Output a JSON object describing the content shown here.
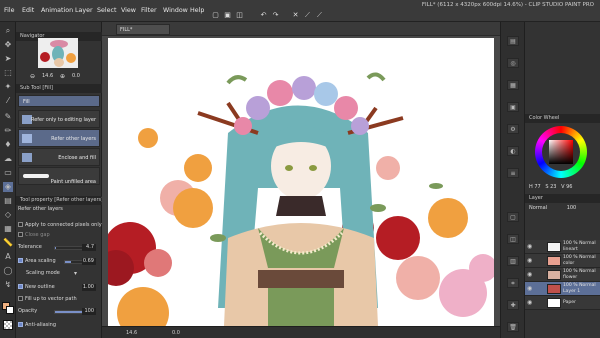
{
  "menu": {
    "items": [
      "File",
      "Edit",
      "Animation",
      "Layer",
      "Select",
      "View",
      "Filter",
      "Window",
      "Help"
    ],
    "title": "FILL* (6112 x 4320px 600dpi 14.6%) - CLIP STUDIO PAINT PRO"
  },
  "navigator": {
    "header": "Navigator",
    "zoom": "14.6",
    "angle": "0.0"
  },
  "subtool": {
    "header": "Sub Tool [Fill]",
    "tool_name": "Fill",
    "items": [
      {
        "label": "Refer only to editing layer",
        "selected": false
      },
      {
        "label": "Refer other layers",
        "selected": true
      },
      {
        "label": "Enclose and fill",
        "selected": false
      },
      {
        "label": "Paint unfilled area",
        "selected": false
      }
    ]
  },
  "tool_property": {
    "header": "Tool property [Refer other layers]",
    "preset": "Refer other layers",
    "apply_connected": "Apply to connected pixels only",
    "close_gap": "Close gap",
    "tolerance_label": "Tolerance",
    "tolerance_value": "4.7",
    "tolerance_pct": 0.05,
    "area_scaling_label": "Area scaling",
    "area_scaling_value": "0.69",
    "area_scaling_pct": 0.35,
    "scaling_mode_label": "Scaling mode",
    "new_outline_label": "New outline",
    "new_outline_value": "1.00",
    "fill_vector_label": "Fill up to vector path",
    "opacity_label": "Opacity",
    "opacity_value": "100",
    "anti_aliasing_label": "Anti-aliasing"
  },
  "canvas": {
    "tab_label": "FILL*",
    "status_zoom": "14.6",
    "status_angle": "0.0"
  },
  "color_wheel": {
    "header": "Color Wheel",
    "h": "77",
    "s": "23",
    "v": "96"
  },
  "layers": {
    "header": "Layer",
    "blend_mode": "Normal",
    "opacity": "100",
    "rows": [
      {
        "pct": "100 %",
        "mode": "Normal",
        "name": "lineart",
        "selected": false
      },
      {
        "pct": "100 %",
        "mode": "Normal",
        "name": "color",
        "selected": false
      },
      {
        "pct": "100 %",
        "mode": "Normal",
        "name": "flower",
        "selected": false
      },
      {
        "pct": "100 %",
        "mode": "Normal",
        "name": "Layer 1",
        "selected": true
      },
      {
        "pct": "",
        "mode": "",
        "name": "Paper",
        "selected": false
      }
    ]
  },
  "colors": {
    "accent": "#5c6f97",
    "hair": "#6fb3b8",
    "rose_red": "#b51d24",
    "peony_orange": "#f0a040",
    "peony_pink": "#efb0c8",
    "robe": "#e8c8a8",
    "green": "#7a9a5a"
  }
}
